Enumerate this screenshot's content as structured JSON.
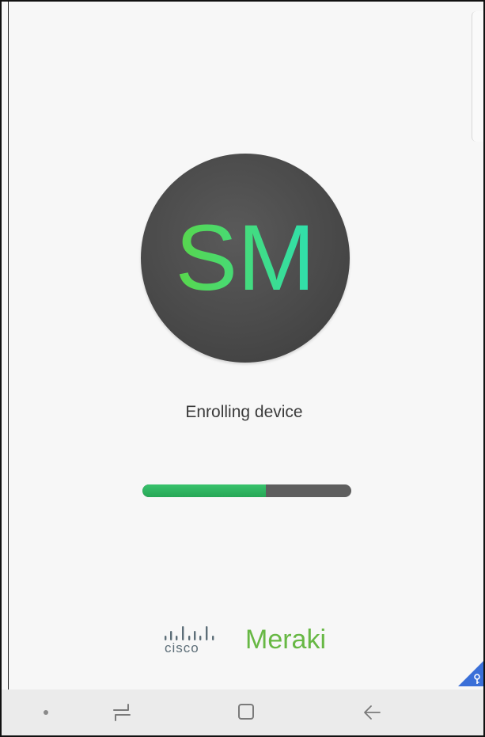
{
  "logo": {
    "text": "SM",
    "icon": "systems-manager-logo-icon"
  },
  "status": {
    "text": "Enrolling device"
  },
  "progress": {
    "fraction": 0.59,
    "fill_color": "#2fb660",
    "track_color": "#5e5e5e"
  },
  "brand": {
    "cisco": "cisco",
    "meraki": "Meraki",
    "meraki_color": "#67b844"
  },
  "navbar": {
    "items": [
      {
        "icon": "dot-indicator-icon"
      },
      {
        "icon": "recent-apps-icon"
      },
      {
        "icon": "home-icon"
      },
      {
        "icon": "back-arrow-icon"
      }
    ]
  },
  "corner_badge": {
    "icon": "key-icon"
  }
}
